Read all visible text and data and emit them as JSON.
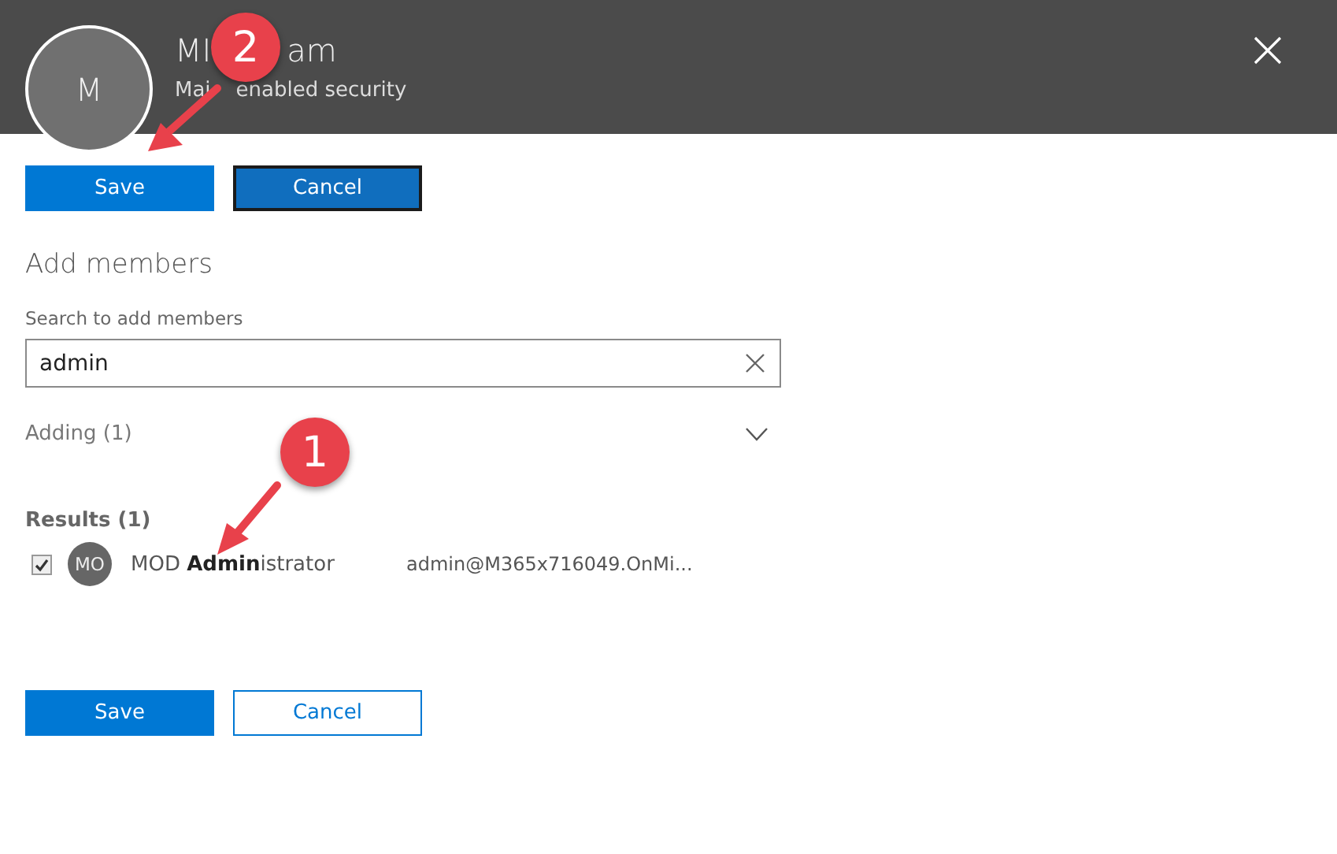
{
  "header": {
    "avatar": "M",
    "title_parts": [
      "MI",
      "am"
    ],
    "subtitle_parts": [
      "Mai",
      "enabled security"
    ]
  },
  "top_buttons": [
    {
      "label": "Save",
      "kind": "primary",
      "focused": false
    },
    {
      "label": "Cancel",
      "kind": "secondary",
      "focused": true
    }
  ],
  "section_title": "Add members",
  "search": {
    "label": "Search to add members",
    "value": "admin"
  },
  "adding": {
    "label": "Adding (1)",
    "expanded": false
  },
  "results": {
    "title": "Results (1)",
    "rows": [
      {
        "checked": true,
        "initials": "MO",
        "name": "MOD **Admin**istrator",
        "email": "admin@M365x716049.OnMi..."
      }
    ]
  },
  "bottom_buttons": [
    {
      "label": "Save",
      "kind": "primary",
      "focused": false
    },
    {
      "label": "Cancel",
      "kind": "secondary",
      "focused": false
    }
  ],
  "annotations": [
    {
      "number": "2"
    },
    {
      "number": "1"
    }
  ]
}
